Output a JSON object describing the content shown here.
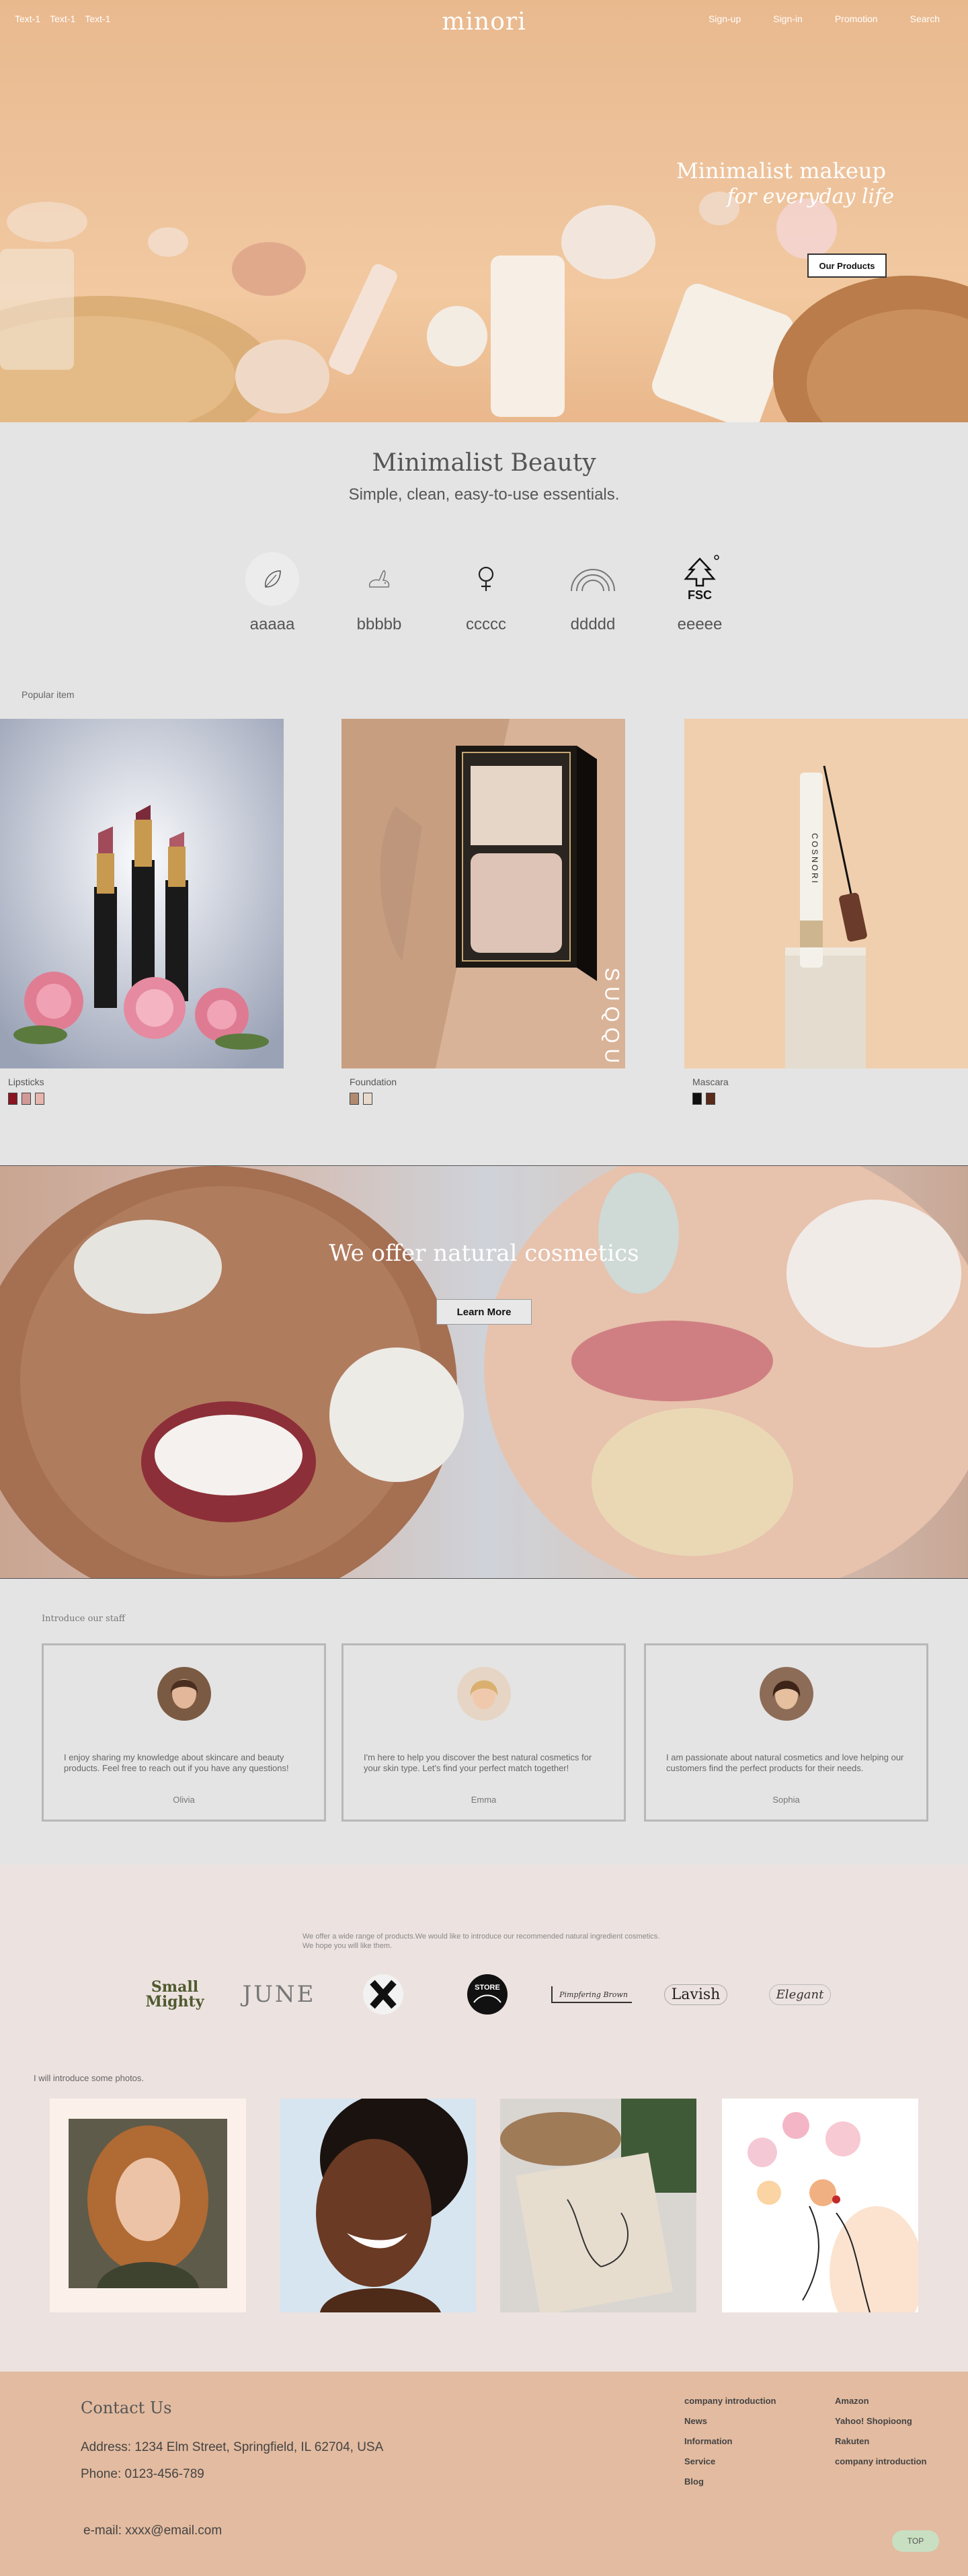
{
  "nav": {
    "left_links": [
      "Text-1",
      "Text-1",
      "Text-1"
    ],
    "logo": "minori",
    "right_links": [
      "Sign-up",
      "Sign-in",
      "Promotion",
      "Search"
    ]
  },
  "hero": {
    "title": "Minimalist makeup",
    "subtitle": "for everyday life",
    "button": "Our Products"
  },
  "beauty": {
    "title": "Minimalist Beauty",
    "subtitle": "Simple, clean, easy-to-use essentials.",
    "features": [
      {
        "icon": "leaf-icon",
        "label": "aaaaa"
      },
      {
        "icon": "rabbit-icon",
        "label": "bbbbb"
      },
      {
        "icon": "female-symbol-icon",
        "label": "ccccc"
      },
      {
        "icon": "rainbow-icon",
        "label": "ddddd"
      },
      {
        "icon": "fsc-tree-icon",
        "label": "eeeee",
        "mark": "FSC"
      }
    ],
    "popular_label": "Popular item",
    "products": [
      {
        "name": "Lipsticks",
        "swatches": [
          "#8a1420",
          "#d19a98",
          "#e6b6ae"
        ]
      },
      {
        "name": "Foundation",
        "swatches": [
          "#b08a70",
          "#e7dacd"
        ]
      },
      {
        "name": "Mascara",
        "swatches": [
          "#111111",
          "#5a2a1a"
        ]
      }
    ],
    "foundation_brand_text": "SUQQU",
    "mascara_brand_text": "COSNORI"
  },
  "natural": {
    "title": "We offer natural cosmetics",
    "button": "Learn More"
  },
  "staff": {
    "heading": "Introduce our staff",
    "members": [
      {
        "name": "Olivia",
        "quote": "I enjoy sharing my knowledge about skincare and beauty products. Feel free to reach out if you have any questions!"
      },
      {
        "name": "Emma",
        "quote": " I'm here to help you discover the best natural cosmetics for your skin type. Let's find your perfect match together!"
      },
      {
        "name": "Sophia",
        "quote": "I am passionate about natural cosmetics and love helping our customers find the perfect products for their needs."
      }
    ]
  },
  "brands": {
    "intro": "We offer a wide range of products.We would like to introduce our recommended natural ingredient cosmetics.  We hope you will like them.",
    "logos": [
      "Small Mighty",
      "JUNE",
      "X",
      "STORE",
      "Pimpfering Brown",
      "Lavish",
      "Elegant"
    ],
    "photos_label": "I will introduce some photos."
  },
  "footer": {
    "contact_title": "Contact Us",
    "address": "Address: 1234 Elm Street, Springfield, IL 62704, USA",
    "phone": "Phone: 0123-456-789",
    "email": "e-mail: xxxx@email.com",
    "col1": [
      "company introduction",
      "News",
      "Information",
      "Service",
      "Blog"
    ],
    "col2": [
      "Amazon",
      "Yahoo! Shopioong",
      "Rakuten",
      "company introduction"
    ],
    "top_button": "TOP"
  }
}
